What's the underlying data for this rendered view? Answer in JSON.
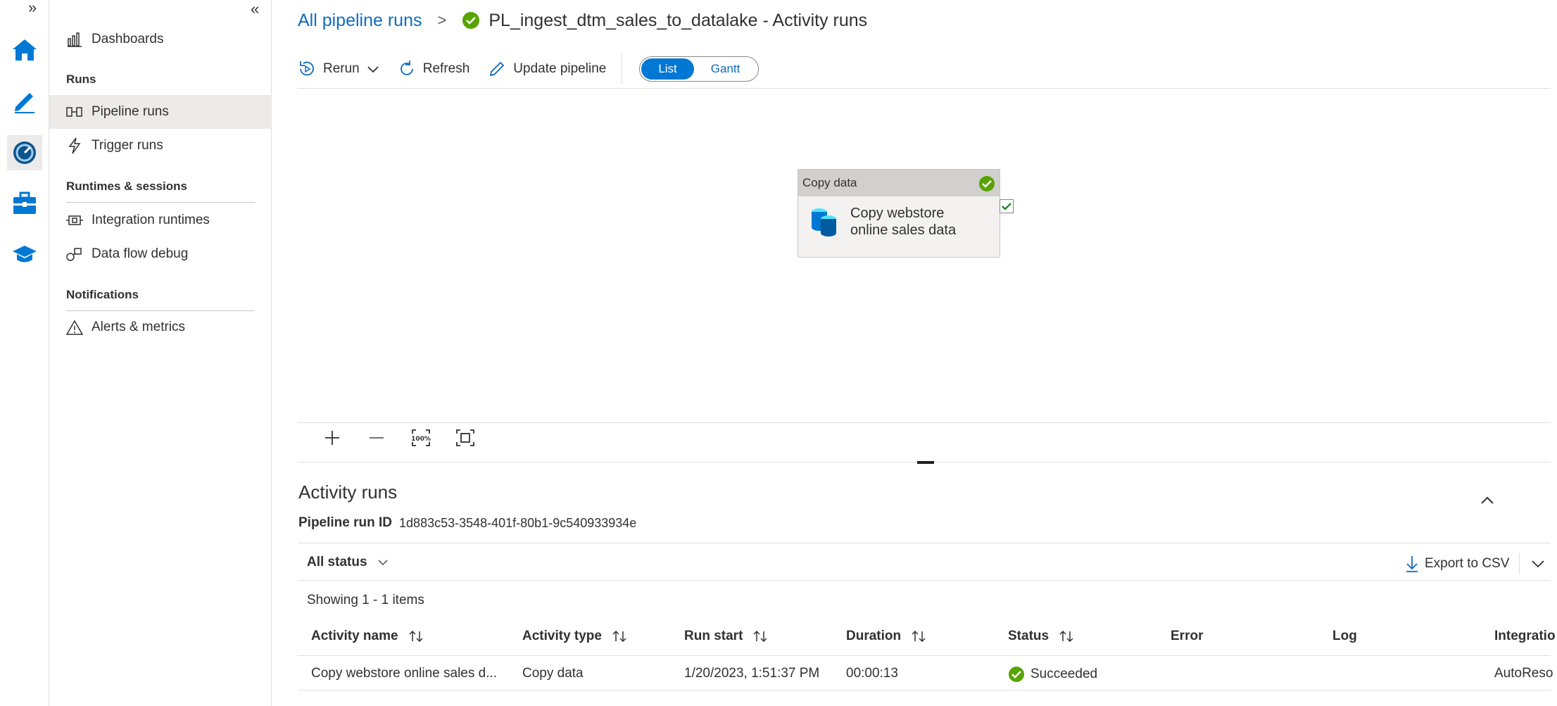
{
  "nav": {
    "items_top": [
      {
        "label": "Dashboards",
        "icon": "dashboards-icon"
      }
    ],
    "sections": [
      {
        "header": "Runs",
        "items": [
          {
            "label": "Pipeline runs",
            "icon": "pipeline-runs-icon",
            "selected": true
          },
          {
            "label": "Trigger runs",
            "icon": "trigger-runs-icon"
          }
        ]
      },
      {
        "header": "Runtimes & sessions",
        "items": [
          {
            "label": "Integration runtimes",
            "icon": "integration-runtimes-icon"
          },
          {
            "label": "Data flow debug",
            "icon": "data-flow-debug-icon"
          }
        ]
      },
      {
        "header": "Notifications",
        "items": [
          {
            "label": "Alerts & metrics",
            "icon": "alerts-icon"
          }
        ]
      }
    ]
  },
  "breadcrumb": {
    "link": "All pipeline runs",
    "separator": ">",
    "title": "PL_ingest_dtm_sales_to_datalake - Activity runs"
  },
  "toolbar": {
    "rerun": "Rerun",
    "refresh": "Refresh",
    "update_pipeline": "Update pipeline",
    "view_list": "List",
    "view_gantt": "Gantt"
  },
  "canvas": {
    "node_type": "Copy data",
    "node_name_line1": "Copy webstore",
    "node_name_line2": "online sales data"
  },
  "activity_runs": {
    "title": "Activity runs",
    "run_id_label": "Pipeline run ID",
    "run_id": "1d883c53-3548-401f-80b1-9c540933934e",
    "filter": "All status",
    "export": "Export to CSV",
    "showing": "Showing 1 - 1 items",
    "columns": [
      "Activity name",
      "Activity type",
      "Run start",
      "Duration",
      "Status",
      "Error",
      "Log",
      "Integratio"
    ],
    "rows": [
      {
        "activity_name": "Copy webstore online sales d...",
        "activity_type": "Copy data",
        "run_start": "1/20/2023, 1:51:37 PM",
        "duration": "00:00:13",
        "status": "Succeeded",
        "error": "",
        "log": "",
        "integration": "AutoReso"
      }
    ]
  },
  "colors": {
    "accent": "#0078d4",
    "link": "#0f6cbd",
    "success": "#57a300"
  }
}
